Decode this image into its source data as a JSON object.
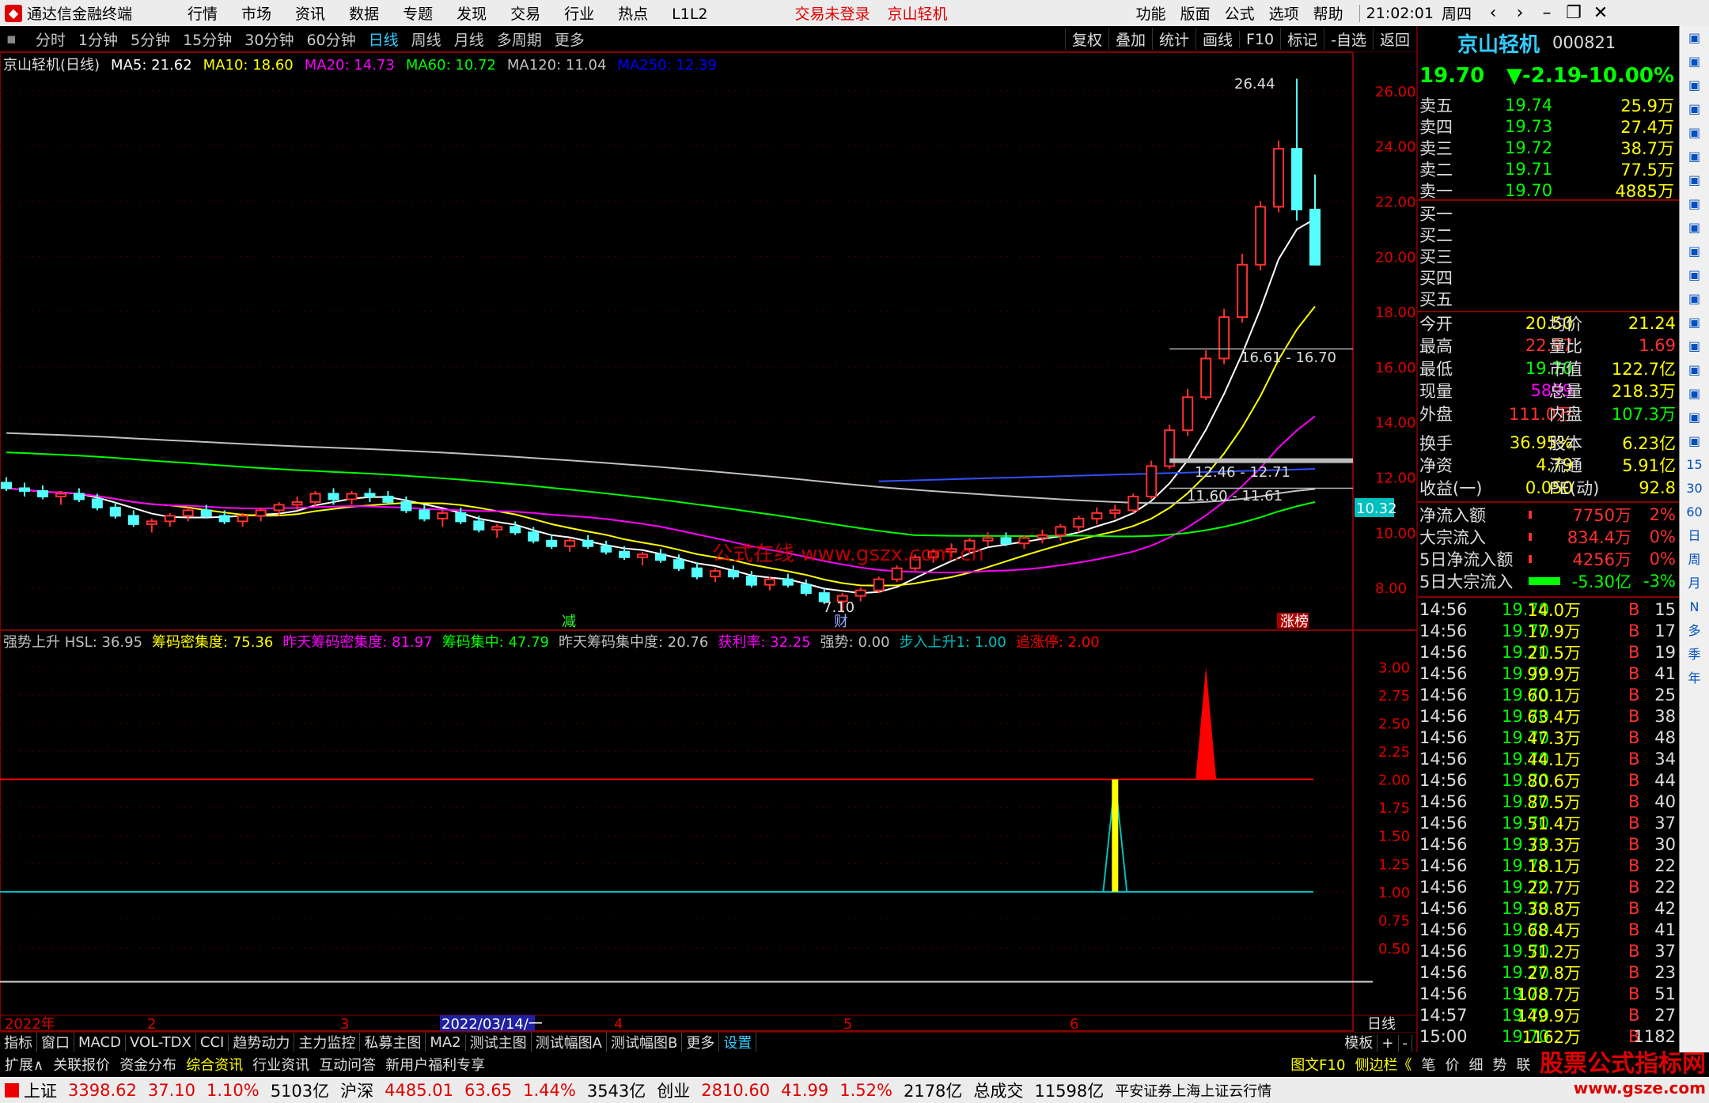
{
  "app": {
    "title": "通达信金融终端",
    "menus": [
      "行情",
      "市场",
      "资讯",
      "数据",
      "专题",
      "发现",
      "交易",
      "行业",
      "热点",
      "L1L2"
    ],
    "trade_status": "交易未登录",
    "stock_title": "京山轻机",
    "right_menus": [
      "功能",
      "版面",
      "公式",
      "选项",
      "帮助"
    ],
    "time": "21:02:01",
    "weekday": "周四"
  },
  "periods": {
    "items": [
      "分时",
      "1分钟",
      "5分钟",
      "15分钟",
      "30分钟",
      "60分钟",
      "日线",
      "周线",
      "月线",
      "多周期",
      "更多"
    ],
    "active": "日线",
    "tools": [
      "复权",
      "叠加",
      "统计",
      "画线",
      "F10",
      "标记",
      "-自选",
      "返回"
    ]
  },
  "main_legend": {
    "name": "京山轻机(日线)",
    "ma": [
      {
        "label": "MA5: 21.62",
        "color": "#ffffff"
      },
      {
        "label": "MA10: 18.60",
        "color": "#ffff00"
      },
      {
        "label": "MA20: 14.73",
        "color": "#ff00ff"
      },
      {
        "label": "MA60: 10.72",
        "color": "#00ff00"
      },
      {
        "label": "MA120: 11.04",
        "color": "#c0c0c0"
      },
      {
        "label": "MA250: 12.39",
        "color": "#0000ff"
      }
    ]
  },
  "ind_legend": {
    "items": [
      {
        "label": "强势上升 HSL: 36.95",
        "color": "#c0c0c0"
      },
      {
        "label": "筹码密集度: 75.36",
        "color": "#ffff00"
      },
      {
        "label": "昨天筹码密集度: 81.97",
        "color": "#ff00ff"
      },
      {
        "label": "筹码集中: 47.79",
        "color": "#00ff00"
      },
      {
        "label": "昨天筹码集中度: 20.76",
        "color": "#c0c0c0"
      },
      {
        "label": "获利率: 32.25",
        "color": "#ff00ff"
      },
      {
        "label": "强势: 0.00",
        "color": "#c0c0c0"
      },
      {
        "label": "步入上升1: 1.00",
        "color": "#00c0c0"
      },
      {
        "label": "追涨停: 2.00",
        "color": "#ff0000"
      }
    ]
  },
  "chart_data": [
    {
      "type": "candlestick",
      "title": "京山轻机(日线)",
      "ylim": [
        6.8,
        27
      ],
      "yticks": [
        "26.00",
        "24.00",
        "22.00",
        "20.00",
        "18.00",
        "16.00",
        "14.00",
        "12.00",
        "10.00",
        "8.00"
      ],
      "last_price_tag": "10.32",
      "annotations": [
        "26.44",
        "16.61 - 16.70",
        "12.46 - 12.71",
        "11.60 - 11.61",
        "7.10",
        "减",
        "财",
        "涨榜"
      ],
      "ohlc": [
        [
          11.8,
          12,
          11.5,
          11.6
        ],
        [
          11.6,
          11.8,
          11.3,
          11.5
        ],
        [
          11.5,
          11.7,
          11.2,
          11.3
        ],
        [
          11.3,
          11.5,
          11,
          11.4
        ],
        [
          11.4,
          11.6,
          11.1,
          11.2
        ],
        [
          11.2,
          11.4,
          10.8,
          10.9
        ],
        [
          10.9,
          11.1,
          10.5,
          10.6
        ],
        [
          10.6,
          10.8,
          10.2,
          10.3
        ],
        [
          10.3,
          10.5,
          10,
          10.4
        ],
        [
          10.4,
          10.7,
          10.2,
          10.6
        ],
        [
          10.6,
          10.9,
          10.4,
          10.8
        ],
        [
          10.8,
          11,
          10.5,
          10.6
        ],
        [
          10.6,
          10.8,
          10.3,
          10.4
        ],
        [
          10.4,
          10.7,
          10.2,
          10.6
        ],
        [
          10.6,
          10.9,
          10.4,
          10.8
        ],
        [
          10.8,
          11.1,
          10.6,
          11
        ],
        [
          11,
          11.3,
          10.8,
          11.1
        ],
        [
          11.1,
          11.5,
          10.9,
          11.4
        ],
        [
          11.4,
          11.6,
          11,
          11.2
        ],
        [
          11.2,
          11.5,
          11,
          11.4
        ],
        [
          11.4,
          11.6,
          11.1,
          11.3
        ],
        [
          11.3,
          11.5,
          11,
          11.1
        ],
        [
          11.1,
          11.3,
          10.7,
          10.8
        ],
        [
          10.8,
          11,
          10.4,
          10.5
        ],
        [
          10.5,
          10.8,
          10.2,
          10.7
        ],
        [
          10.7,
          10.9,
          10.3,
          10.4
        ],
        [
          10.4,
          10.6,
          10,
          10.1
        ],
        [
          10.1,
          10.3,
          9.8,
          10.2
        ],
        [
          10.2,
          10.4,
          9.9,
          10
        ],
        [
          10,
          10.2,
          9.6,
          9.7
        ],
        [
          9.7,
          9.9,
          9.4,
          9.5
        ],
        [
          9.5,
          9.8,
          9.3,
          9.7
        ],
        [
          9.7,
          9.9,
          9.4,
          9.5
        ],
        [
          9.5,
          9.7,
          9.2,
          9.3
        ],
        [
          9.3,
          9.5,
          9,
          9.1
        ],
        [
          9.1,
          9.3,
          8.8,
          9.2
        ],
        [
          9.2,
          9.4,
          8.9,
          9
        ],
        [
          9,
          9.2,
          8.6,
          8.7
        ],
        [
          8.7,
          8.9,
          8.3,
          8.4
        ],
        [
          8.4,
          8.7,
          8.2,
          8.6
        ],
        [
          8.6,
          8.8,
          8.3,
          8.4
        ],
        [
          8.4,
          8.6,
          8,
          8.1
        ],
        [
          8.1,
          8.4,
          7.9,
          8.3
        ],
        [
          8.3,
          8.5,
          8,
          8.1
        ],
        [
          8.1,
          8.3,
          7.7,
          7.8
        ],
        [
          7.8,
          8,
          7.4,
          7.5
        ],
        [
          7.5,
          7.8,
          7.1,
          7.7
        ],
        [
          7.7,
          8,
          7.5,
          7.9
        ],
        [
          7.9,
          8.4,
          7.8,
          8.3
        ],
        [
          8.3,
          8.8,
          8.2,
          8.7
        ],
        [
          8.7,
          9.2,
          8.6,
          9.1
        ],
        [
          9.1,
          9.4,
          8.9,
          9.3
        ],
        [
          9.3,
          9.6,
          9.1,
          9.4
        ],
        [
          9.4,
          9.8,
          9.2,
          9.7
        ],
        [
          9.7,
          10,
          9.5,
          9.8
        ],
        [
          9.8,
          10,
          9.5,
          9.6
        ],
        [
          9.6,
          9.9,
          9.4,
          9.8
        ],
        [
          9.8,
          10.1,
          9.6,
          9.9
        ],
        [
          9.9,
          10.3,
          9.7,
          10.2
        ],
        [
          10.2,
          10.6,
          10,
          10.5
        ],
        [
          10.5,
          10.9,
          10.3,
          10.7
        ],
        [
          10.7,
          11,
          10.5,
          10.8
        ],
        [
          10.8,
          11.4,
          10.7,
          11.3
        ],
        [
          11.3,
          12.6,
          11.2,
          12.4
        ],
        [
          12.4,
          13.9,
          12.3,
          13.7
        ],
        [
          13.7,
          15.2,
          13.5,
          14.9
        ],
        [
          14.9,
          16.6,
          14.8,
          16.3
        ],
        [
          16.3,
          18.1,
          16.1,
          17.8
        ],
        [
          17.8,
          20.1,
          17.6,
          19.7
        ],
        [
          19.7,
          22,
          19.5,
          21.8
        ],
        [
          21.8,
          24.2,
          21.6,
          23.9
        ],
        [
          23.9,
          26.44,
          21.3,
          21.7
        ],
        [
          21.7,
          22.97,
          19.7,
          19.7
        ]
      ]
    },
    {
      "type": "line",
      "title": "强势上升",
      "ylim": [
        0,
        3.2
      ],
      "yticks": [
        "3.00",
        "2.75",
        "2.50",
        "2.25",
        "2.00",
        "1.75",
        "1.50",
        "1.25",
        "1.00",
        "0.75",
        "0.50"
      ]
    }
  ],
  "timeaxis": {
    "labels": [
      "2022年",
      "2",
      "3",
      "2022/03/14/一",
      "4",
      "5",
      "6"
    ],
    "right": "日线"
  },
  "tabs1": [
    "指标",
    "窗口",
    "MACD",
    "VOL-TDX",
    "CCI",
    "趋势动力",
    "主力监控",
    "私募主图",
    "MA2",
    "测试主图",
    "测试幅图A",
    "测试幅图B",
    "更多",
    "设置"
  ],
  "tabs1_right": [
    "模板",
    "+",
    "-"
  ],
  "tabs2": [
    "扩展∧",
    "关联报价",
    "资金分布",
    "综合资讯",
    "行业资讯",
    "互动问答",
    "新用户福利专享"
  ],
  "tabs2_right": [
    "图文F10",
    "侧边栏《",
    "笔",
    "价",
    "细",
    "势",
    "联"
  ],
  "quote": {
    "name": "京山轻机",
    "code": "000821",
    "price": "19.70",
    "change": "▼-2.19",
    "pct": "-10.00%",
    "asks": [
      [
        "卖五",
        "19.74",
        "25.9万"
      ],
      [
        "卖四",
        "19.73",
        "27.4万"
      ],
      [
        "卖三",
        "19.72",
        "38.7万"
      ],
      [
        "卖二",
        "19.71",
        "77.5万"
      ],
      [
        "卖一",
        "19.70",
        "4885万"
      ]
    ],
    "bids": [
      "买一",
      "买二",
      "买三",
      "买四",
      "买五"
    ],
    "stats": [
      [
        "今开",
        "20.50",
        "均价",
        "21.24"
      ],
      [
        "最高",
        "22.97",
        "量比",
        "1.69"
      ],
      [
        "最低",
        "19.70",
        "市值",
        "122.7亿"
      ],
      [
        "现量",
        "5899",
        "总量",
        "218.3万"
      ],
      [
        "外盘",
        "111.0万",
        "内盘",
        "107.3万"
      ],
      [
        "换手",
        "36.95%",
        "股本",
        "6.23亿"
      ],
      [
        "净资",
        "4.79",
        "流通",
        "5.91亿"
      ],
      [
        "收益(一)",
        "0.050",
        "PE(动)",
        "92.8"
      ]
    ],
    "flows": [
      [
        "净流入额",
        "7750万",
        "2%"
      ],
      [
        "大宗流入",
        "834.4万",
        "0%"
      ],
      [
        "5日净流入额",
        "4256万",
        "0%"
      ],
      [
        "5日大宗流入",
        "-5.30亿",
        "-3%"
      ]
    ],
    "ticks": [
      [
        "14:56",
        "19.70",
        "14.0万",
        "B",
        "15"
      ],
      [
        "14:56",
        "19.70",
        "17.9万",
        "B",
        "17"
      ],
      [
        "14:56",
        "19.70",
        "21.5万",
        "B",
        "19"
      ],
      [
        "14:56",
        "19.70",
        "99.9万",
        "B",
        "41"
      ],
      [
        "14:56",
        "19.70",
        "60.1万",
        "B",
        "25"
      ],
      [
        "14:56",
        "19.70",
        "63.4万",
        "B",
        "38"
      ],
      [
        "14:56",
        "19.70",
        "47.3万",
        "B",
        "48"
      ],
      [
        "14:56",
        "19.70",
        "44.1万",
        "B",
        "34"
      ],
      [
        "14:56",
        "19.70",
        "80.6万",
        "B",
        "44"
      ],
      [
        "14:56",
        "19.70",
        "87.5万",
        "B",
        "40"
      ],
      [
        "14:56",
        "19.70",
        "51.4万",
        "B",
        "37"
      ],
      [
        "14:56",
        "19.70",
        "33.3万",
        "B",
        "30"
      ],
      [
        "14:56",
        "19.70",
        "18.1万",
        "B",
        "22"
      ],
      [
        "14:56",
        "19.70",
        "22.7万",
        "B",
        "22"
      ],
      [
        "14:56",
        "19.70",
        "38.8万",
        "B",
        "42"
      ],
      [
        "14:56",
        "19.70",
        "68.4万",
        "B",
        "41"
      ],
      [
        "14:56",
        "19.70",
        "51.2万",
        "B",
        "37"
      ],
      [
        "14:56",
        "19.70",
        "27.8万",
        "B",
        "23"
      ],
      [
        "14:56",
        "19.70",
        "108.7万",
        "B",
        "51"
      ],
      [
        "14:57",
        "19.70",
        "149.9万",
        "B",
        "27"
      ],
      [
        "15:00",
        "19.70",
        "1162万",
        "B",
        "1182"
      ]
    ]
  },
  "sidebar": [
    "15",
    "30",
    "60",
    "日",
    "周",
    "月",
    "N",
    "多",
    "季",
    "年"
  ],
  "status": {
    "items": [
      [
        "上证",
        "3398.62",
        "37.10",
        "1.10%",
        "5103亿"
      ],
      [
        "沪深",
        "4485.01",
        "63.65",
        "1.44%",
        "3543亿"
      ],
      [
        "创业",
        "2810.60",
        "41.99",
        "1.52%",
        "2178亿"
      ]
    ],
    "total_label": "总成交",
    "total": "11598亿",
    "source": "平安证券上海上证云行情"
  },
  "watermark": "公式在线 www.gszx.com.cn",
  "brand": {
    "name": "股票公式指标网",
    "url": "www.gsze.com"
  }
}
